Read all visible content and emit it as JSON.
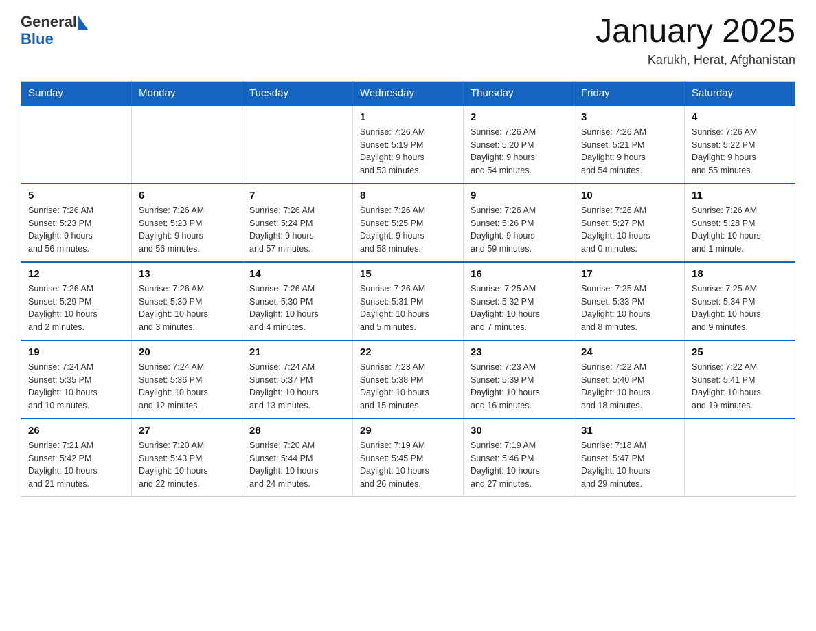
{
  "header": {
    "logo_general": "General",
    "logo_blue": "Blue",
    "title": "January 2025",
    "subtitle": "Karukh, Herat, Afghanistan"
  },
  "days_of_week": [
    "Sunday",
    "Monday",
    "Tuesday",
    "Wednesday",
    "Thursday",
    "Friday",
    "Saturday"
  ],
  "weeks": [
    [
      {
        "day": "",
        "info": ""
      },
      {
        "day": "",
        "info": ""
      },
      {
        "day": "",
        "info": ""
      },
      {
        "day": "1",
        "info": "Sunrise: 7:26 AM\nSunset: 5:19 PM\nDaylight: 9 hours\nand 53 minutes."
      },
      {
        "day": "2",
        "info": "Sunrise: 7:26 AM\nSunset: 5:20 PM\nDaylight: 9 hours\nand 54 minutes."
      },
      {
        "day": "3",
        "info": "Sunrise: 7:26 AM\nSunset: 5:21 PM\nDaylight: 9 hours\nand 54 minutes."
      },
      {
        "day": "4",
        "info": "Sunrise: 7:26 AM\nSunset: 5:22 PM\nDaylight: 9 hours\nand 55 minutes."
      }
    ],
    [
      {
        "day": "5",
        "info": "Sunrise: 7:26 AM\nSunset: 5:23 PM\nDaylight: 9 hours\nand 56 minutes."
      },
      {
        "day": "6",
        "info": "Sunrise: 7:26 AM\nSunset: 5:23 PM\nDaylight: 9 hours\nand 56 minutes."
      },
      {
        "day": "7",
        "info": "Sunrise: 7:26 AM\nSunset: 5:24 PM\nDaylight: 9 hours\nand 57 minutes."
      },
      {
        "day": "8",
        "info": "Sunrise: 7:26 AM\nSunset: 5:25 PM\nDaylight: 9 hours\nand 58 minutes."
      },
      {
        "day": "9",
        "info": "Sunrise: 7:26 AM\nSunset: 5:26 PM\nDaylight: 9 hours\nand 59 minutes."
      },
      {
        "day": "10",
        "info": "Sunrise: 7:26 AM\nSunset: 5:27 PM\nDaylight: 10 hours\nand 0 minutes."
      },
      {
        "day": "11",
        "info": "Sunrise: 7:26 AM\nSunset: 5:28 PM\nDaylight: 10 hours\nand 1 minute."
      }
    ],
    [
      {
        "day": "12",
        "info": "Sunrise: 7:26 AM\nSunset: 5:29 PM\nDaylight: 10 hours\nand 2 minutes."
      },
      {
        "day": "13",
        "info": "Sunrise: 7:26 AM\nSunset: 5:30 PM\nDaylight: 10 hours\nand 3 minutes."
      },
      {
        "day": "14",
        "info": "Sunrise: 7:26 AM\nSunset: 5:30 PM\nDaylight: 10 hours\nand 4 minutes."
      },
      {
        "day": "15",
        "info": "Sunrise: 7:26 AM\nSunset: 5:31 PM\nDaylight: 10 hours\nand 5 minutes."
      },
      {
        "day": "16",
        "info": "Sunrise: 7:25 AM\nSunset: 5:32 PM\nDaylight: 10 hours\nand 7 minutes."
      },
      {
        "day": "17",
        "info": "Sunrise: 7:25 AM\nSunset: 5:33 PM\nDaylight: 10 hours\nand 8 minutes."
      },
      {
        "day": "18",
        "info": "Sunrise: 7:25 AM\nSunset: 5:34 PM\nDaylight: 10 hours\nand 9 minutes."
      }
    ],
    [
      {
        "day": "19",
        "info": "Sunrise: 7:24 AM\nSunset: 5:35 PM\nDaylight: 10 hours\nand 10 minutes."
      },
      {
        "day": "20",
        "info": "Sunrise: 7:24 AM\nSunset: 5:36 PM\nDaylight: 10 hours\nand 12 minutes."
      },
      {
        "day": "21",
        "info": "Sunrise: 7:24 AM\nSunset: 5:37 PM\nDaylight: 10 hours\nand 13 minutes."
      },
      {
        "day": "22",
        "info": "Sunrise: 7:23 AM\nSunset: 5:38 PM\nDaylight: 10 hours\nand 15 minutes."
      },
      {
        "day": "23",
        "info": "Sunrise: 7:23 AM\nSunset: 5:39 PM\nDaylight: 10 hours\nand 16 minutes."
      },
      {
        "day": "24",
        "info": "Sunrise: 7:22 AM\nSunset: 5:40 PM\nDaylight: 10 hours\nand 18 minutes."
      },
      {
        "day": "25",
        "info": "Sunrise: 7:22 AM\nSunset: 5:41 PM\nDaylight: 10 hours\nand 19 minutes."
      }
    ],
    [
      {
        "day": "26",
        "info": "Sunrise: 7:21 AM\nSunset: 5:42 PM\nDaylight: 10 hours\nand 21 minutes."
      },
      {
        "day": "27",
        "info": "Sunrise: 7:20 AM\nSunset: 5:43 PM\nDaylight: 10 hours\nand 22 minutes."
      },
      {
        "day": "28",
        "info": "Sunrise: 7:20 AM\nSunset: 5:44 PM\nDaylight: 10 hours\nand 24 minutes."
      },
      {
        "day": "29",
        "info": "Sunrise: 7:19 AM\nSunset: 5:45 PM\nDaylight: 10 hours\nand 26 minutes."
      },
      {
        "day": "30",
        "info": "Sunrise: 7:19 AM\nSunset: 5:46 PM\nDaylight: 10 hours\nand 27 minutes."
      },
      {
        "day": "31",
        "info": "Sunrise: 7:18 AM\nSunset: 5:47 PM\nDaylight: 10 hours\nand 29 minutes."
      },
      {
        "day": "",
        "info": ""
      }
    ]
  ]
}
